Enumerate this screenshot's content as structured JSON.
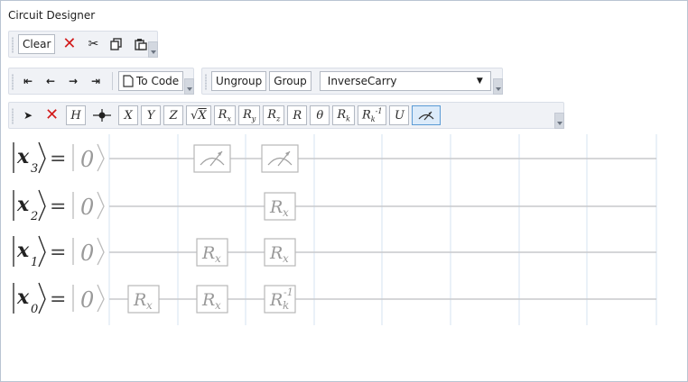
{
  "window": {
    "title": "Circuit Designer"
  },
  "toolbar1": {
    "clear_label": "Clear",
    "icons": [
      "delete-icon",
      "cut-icon",
      "copy-icon",
      "paste-icon"
    ]
  },
  "toolbar2": {
    "nav_icons": [
      "first-icon",
      "back-icon",
      "forward-icon",
      "last-icon"
    ],
    "to_code_label": "To Code",
    "ungroup_label": "Ungroup",
    "group_label": "Group",
    "combo_value": "InverseCarry"
  },
  "toolbar3": {
    "gates": [
      "H",
      "Z"
    ],
    "gate_x": "X",
    "gate_y": "Y",
    "gate_r": "R",
    "gate_theta": "θ",
    "gate_u": "U",
    "rx_base": "R",
    "rx_sub": "x",
    "ry_base": "R",
    "ry_sub": "y",
    "rz_base": "R",
    "rz_sub": "z",
    "rk_base": "R",
    "rk_sub": "k",
    "rkinv_base": "R",
    "rkinv_sub": "k",
    "rkinv_sup": "-1",
    "sqrt_x": "X"
  },
  "circuit": {
    "qubits": [
      {
        "name": "x",
        "index": "3",
        "eq": "=",
        "ket": "0"
      },
      {
        "name": "x",
        "index": "2",
        "eq": "=",
        "ket": "0"
      },
      {
        "name": "x",
        "index": "1",
        "eq": "=",
        "ket": "0"
      },
      {
        "name": "x",
        "index": "0",
        "eq": "=",
        "ket": "0"
      }
    ],
    "gate_label": {
      "base": "R",
      "sub": "x",
      "k": "k",
      "inv": "-1"
    },
    "accent": "#5b9bd5",
    "wire_color": "#c7c9cc",
    "gridline_color": "#d4e3f2"
  }
}
